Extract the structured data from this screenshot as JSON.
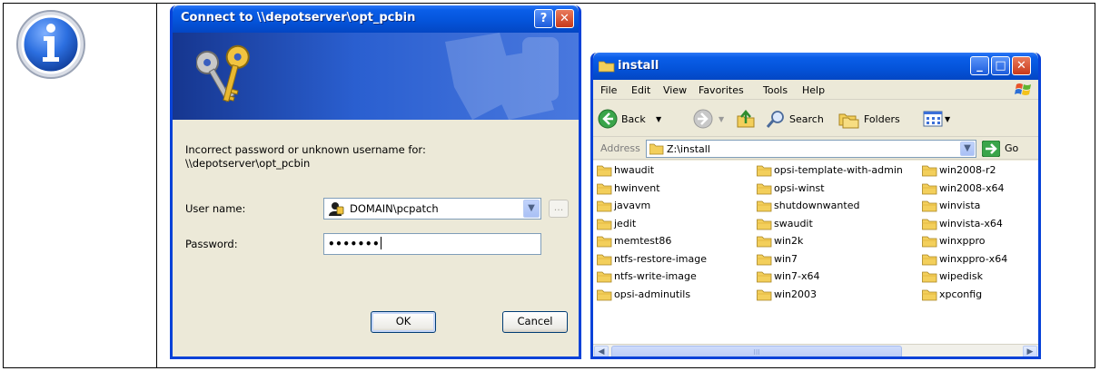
{
  "credentials_dialog": {
    "title": "Connect to \\\\depotserver\\opt_pcbin",
    "help_button": "?",
    "close_button": "✕",
    "message_line1": "Incorrect password or unknown username for:",
    "message_line2": "\\\\depotserver\\opt_pcbin",
    "username_label": "User name:",
    "username_value": "DOMAIN\\pcpatch",
    "password_label": "Password:",
    "password_value": "•••••••",
    "browse_button": "...",
    "ok_button": "OK",
    "cancel_button": "Cancel"
  },
  "explorer": {
    "title": "install",
    "menu": [
      "File",
      "Edit",
      "View",
      "Favorites",
      "Tools",
      "Help"
    ],
    "toolbar": {
      "back": "Back",
      "search": "Search",
      "folders": "Folders"
    },
    "address_label": "Address",
    "address_value": "Z:\\install",
    "go_label": "Go",
    "folders": [
      [
        "hwaudit",
        "hwinvent",
        "javavm",
        "jedit",
        "memtest86",
        "ntfs-restore-image",
        "ntfs-write-image",
        "opsi-adminutils"
      ],
      [
        "opsi-template-with-admin",
        "opsi-winst",
        "shutdownwanted",
        "swaudit",
        "win2k",
        "win7",
        "win7-x64",
        "win2003"
      ],
      [
        "win2008-r2",
        "win2008-x64",
        "winvista",
        "winvista-x64",
        "winxppro",
        "winxppro-x64",
        "wipedisk",
        "xpconfig"
      ]
    ],
    "scroll_grip": "III"
  },
  "colors": {
    "xp_title_blue": "#0453d9",
    "dialog_face": "#ece9d8",
    "folder_yellow": "#f3cf5b",
    "close_red": "#c8391a"
  },
  "icons": {
    "info": "info-icon",
    "keys": "keys-icon",
    "user": "user-icon",
    "folder": "folder-icon"
  }
}
